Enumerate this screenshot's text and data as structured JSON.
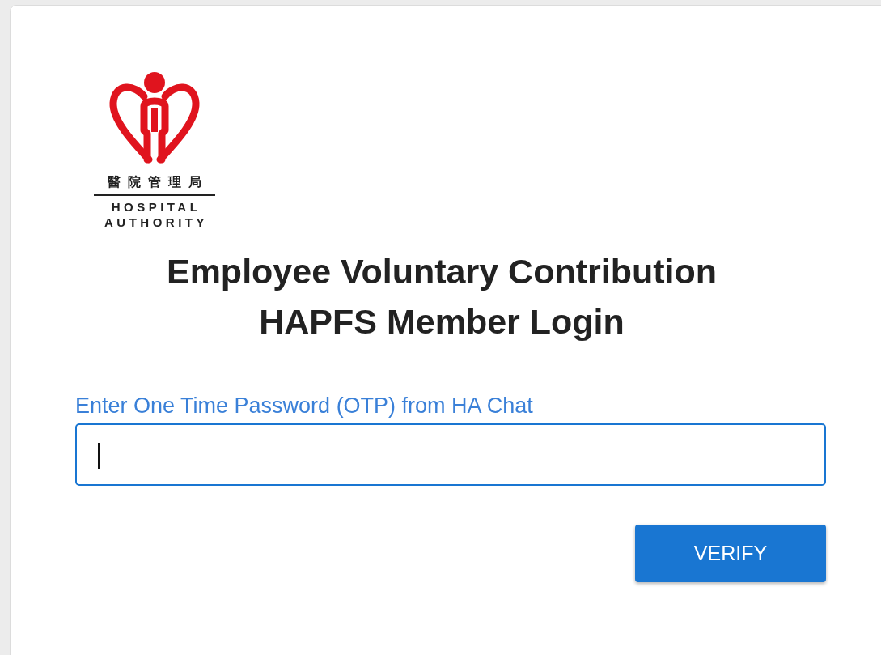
{
  "logo": {
    "chinese_name": "醫院管理局",
    "english_name": [
      "HOSPITAL",
      "AUTHORITY"
    ]
  },
  "title": [
    "Employee Voluntary Contribution",
    "HAPFS Member Login"
  ],
  "otp_field": {
    "label": "Enter One Time Password (OTP) from HA Chat",
    "focused": true
  },
  "verify_button": {
    "label": "VERIFY"
  }
}
